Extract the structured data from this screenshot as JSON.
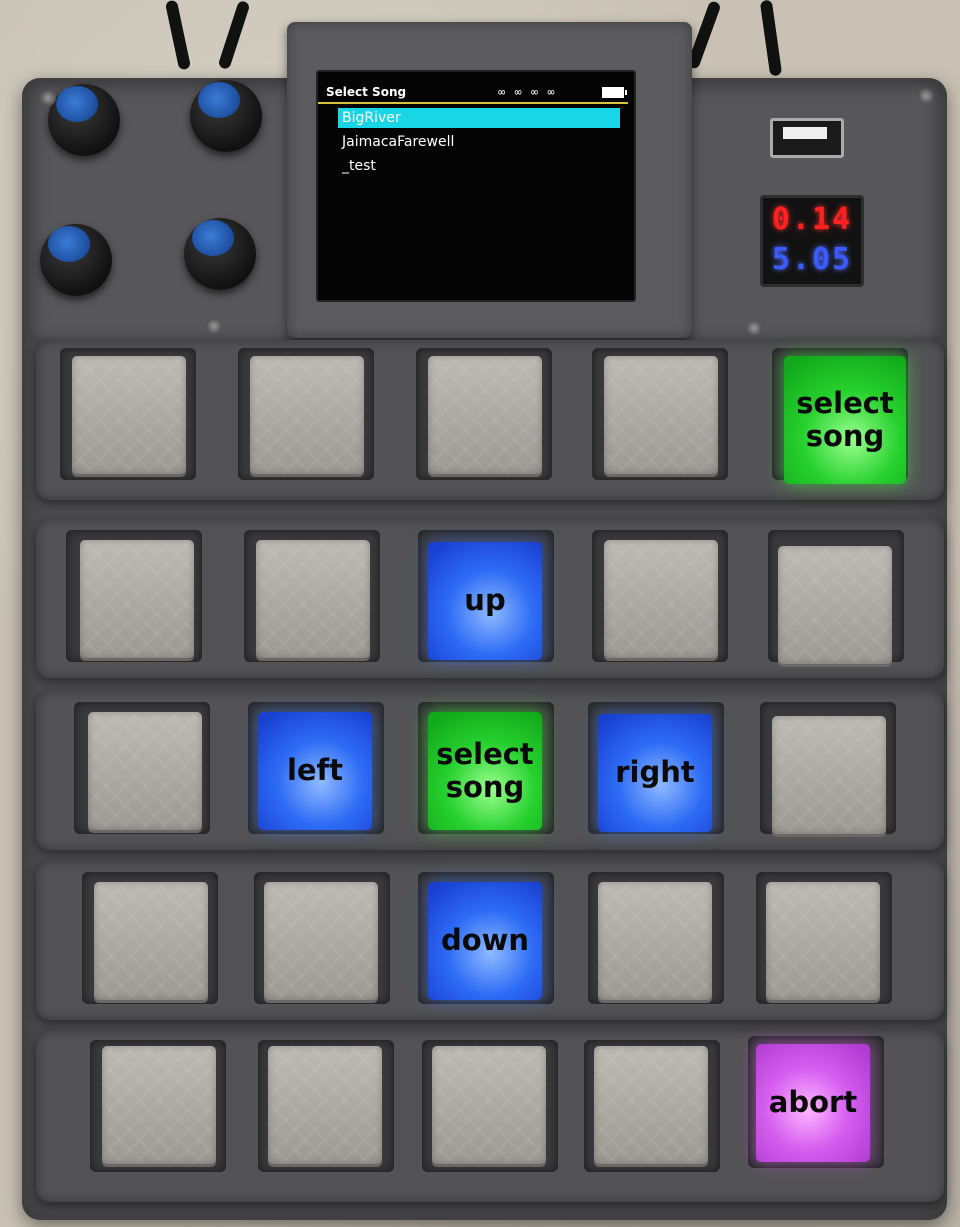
{
  "screen": {
    "title": "Select Song",
    "status": "∞ ∞ ∞ ∞",
    "songs": [
      "BigRiver",
      "JaimacaFarewell",
      "_test"
    ]
  },
  "voltmeter": {
    "top": "0.14",
    "bottom": "5.05"
  },
  "keys": {
    "select_song_top": "select song",
    "up": "up",
    "left": "left",
    "select_song_center": "select song",
    "right": "right",
    "down": "down",
    "abort": "abort"
  },
  "colors": {
    "green": "#27d12f",
    "blue": "#2e6cf5",
    "pink": "#d65ff0",
    "screen_highlight": "#19d6e6",
    "header_line": "#d8c63a"
  },
  "icons": [
    "knob-icon",
    "usb-port-icon",
    "screw-icon",
    "battery-icon"
  ]
}
